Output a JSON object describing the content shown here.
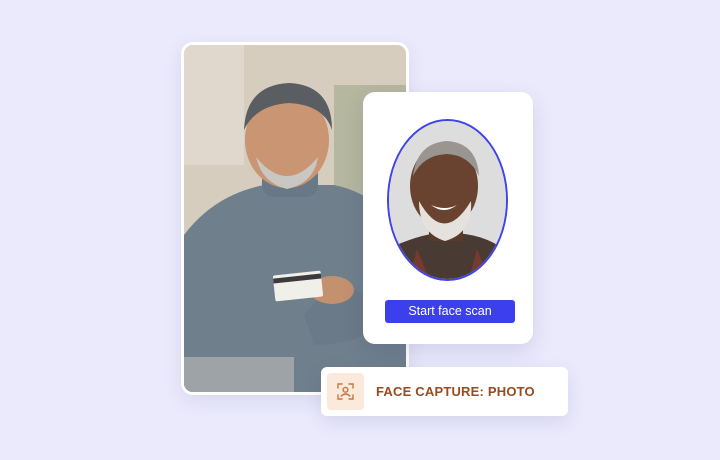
{
  "scan_card": {
    "button_label": "Start face scan"
  },
  "capture_card": {
    "label": "FACE CAPTURE: PHOTO",
    "icon": "face-scan-icon"
  },
  "colors": {
    "background": "#ebeafc",
    "accent_blue": "#3c3fee",
    "capture_text": "#9a4a1e",
    "capture_icon_bg": "#fbeadb"
  }
}
